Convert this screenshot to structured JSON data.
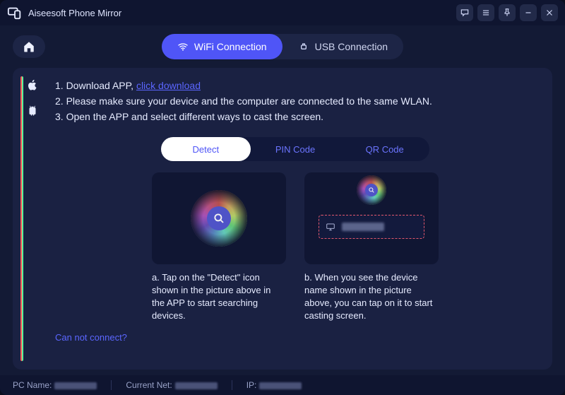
{
  "titlebar": {
    "title": "Aiseesoft Phone Mirror"
  },
  "tabs": {
    "wifi": "WiFi Connection",
    "usb": "USB Connection"
  },
  "instructions": {
    "line1_prefix": "1. Download APP, ",
    "line1_link": "click download",
    "line2": "2. Please make sure your device and the computer are connected to the same WLAN.",
    "line3": "3. Open the APP and select different ways to cast the screen."
  },
  "methods": {
    "detect": "Detect",
    "pin": "PIN Code",
    "qr": "QR Code"
  },
  "cards": {
    "a": "a. Tap on the \"Detect\" icon shown in the picture above in the APP to start searching devices.",
    "b": "b. When you see the device name shown in the picture above, you can tap on it to start casting screen."
  },
  "links": {
    "cannot": "Can not connect?"
  },
  "status": {
    "pcname_label": "PC Name:",
    "net_label": "Current Net:",
    "ip_label": "IP:"
  }
}
